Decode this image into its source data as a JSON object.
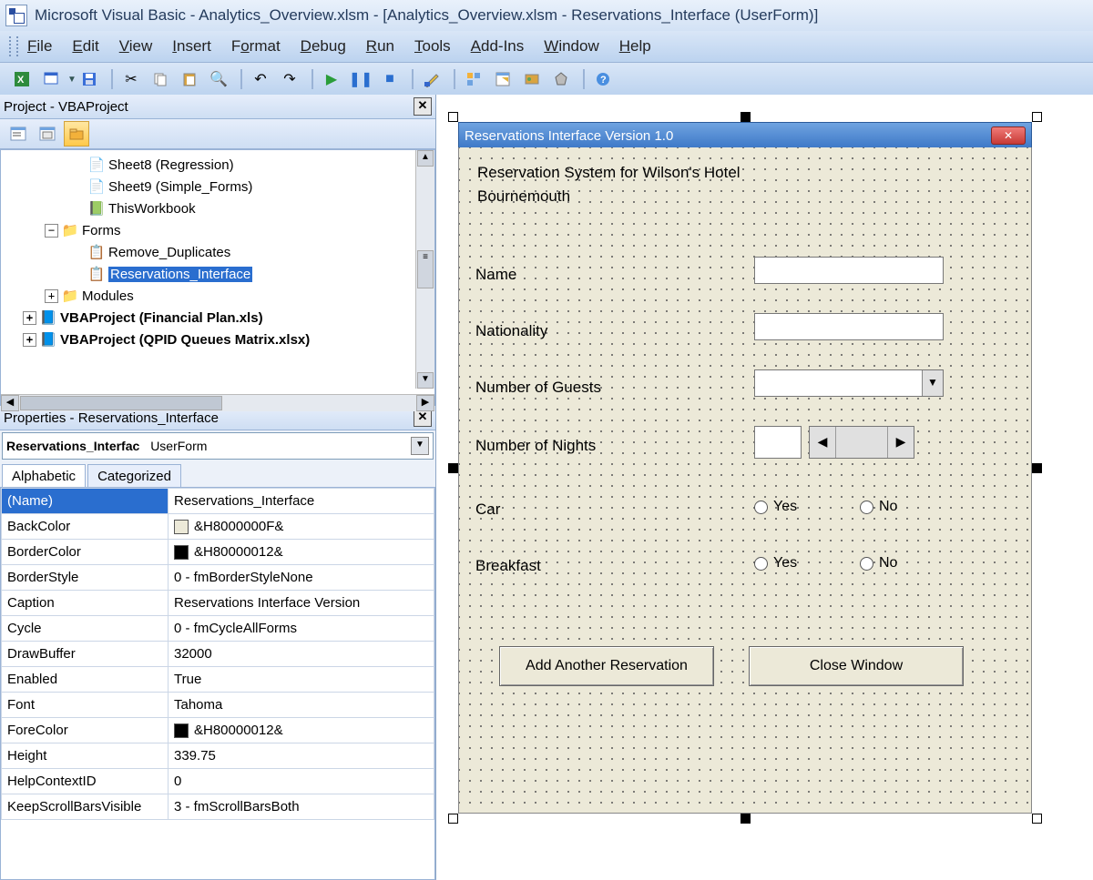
{
  "title": "Microsoft Visual Basic - Analytics_Overview.xlsm - [Analytics_Overview.xlsm - Reservations_Interface (UserForm)]",
  "menu": [
    "File",
    "Edit",
    "View",
    "Insert",
    "Format",
    "Debug",
    "Run",
    "Tools",
    "Add-Ins",
    "Window",
    "Help"
  ],
  "project_explorer": {
    "title": "Project - VBAProject",
    "nodes": {
      "sheet8": "Sheet8 (Regression)",
      "sheet9": "Sheet9 (Simple_Forms)",
      "thiswb": "ThisWorkbook",
      "forms": "Forms",
      "remdup": "Remove_Duplicates",
      "resv": "Reservations_Interface",
      "modules": "Modules",
      "proj2": "VBAProject (Financial Plan.xls)",
      "proj3": "VBAProject (QPID Queues Matrix.xlsx)"
    }
  },
  "properties": {
    "title": "Properties - Reservations_Interface",
    "object": "Reservations_Interfac",
    "objtype": "UserForm",
    "tabs": {
      "alpha": "Alphabetic",
      "cat": "Categorized"
    },
    "rows": [
      {
        "k": "(Name)",
        "v": "Reservations_Interface",
        "name": true
      },
      {
        "k": "BackColor",
        "v": "&H8000000F&",
        "sw": "#ece9d8"
      },
      {
        "k": "BorderColor",
        "v": "&H80000012&",
        "sw": "#000000"
      },
      {
        "k": "BorderStyle",
        "v": "0 - fmBorderStyleNone"
      },
      {
        "k": "Caption",
        "v": "Reservations Interface Version"
      },
      {
        "k": "Cycle",
        "v": "0 - fmCycleAllForms"
      },
      {
        "k": "DrawBuffer",
        "v": "32000"
      },
      {
        "k": "Enabled",
        "v": "True"
      },
      {
        "k": "Font",
        "v": "Tahoma"
      },
      {
        "k": "ForeColor",
        "v": "&H80000012&",
        "sw": "#000000"
      },
      {
        "k": "Height",
        "v": "339.75"
      },
      {
        "k": "HelpContextID",
        "v": "0"
      },
      {
        "k": "KeepScrollBarsVisible",
        "v": "3 - fmScrollBarsBoth"
      }
    ]
  },
  "userform": {
    "caption": "Reservations Interface Version 1.0",
    "heading1": "Reservation System for Wilson's Hotel",
    "heading2": "Bournemouth",
    "labels": {
      "name": "Name",
      "nat": "Nationality",
      "guests": "Number of Guests",
      "nights": "Number of Nights",
      "car": "Car",
      "bf": "Breakfast"
    },
    "radios": {
      "yes": "Yes",
      "no": "No"
    },
    "buttons": {
      "add": "Add Another Reservation",
      "close": "Close Window"
    }
  }
}
